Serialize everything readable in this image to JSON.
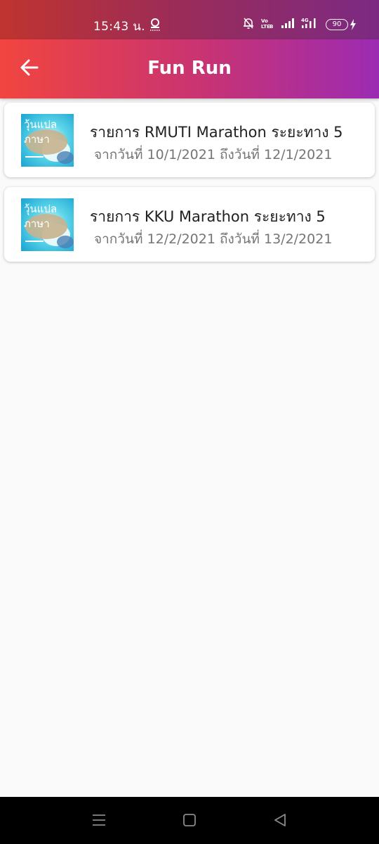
{
  "status_bar": {
    "time": "15:43 น.",
    "battery": "90"
  },
  "app_bar": {
    "title": "Fun Run"
  },
  "events": [
    {
      "title": "รายการ RMUTI Marathon ระยะทาง 5",
      "subtitle": "จากวันที่ 10/1/2021 ถึงวันที่ 12/1/2021",
      "thumb_text_1": "วุ้นแปล",
      "thumb_text_2": "ภาษา"
    },
    {
      "title": "รายการ KKU Marathon ระยะทาง 5",
      "subtitle": "จากวันที่ 12/2/2021 ถึงวันที่ 13/2/2021",
      "thumb_text_1": "วุ้นแปล",
      "thumb_text_2": "ภาษา"
    }
  ],
  "icons": {
    "back": "arrow-back-icon",
    "menu": "menu-icon",
    "home": "home-icon",
    "nav_back": "triangle-back-icon"
  }
}
